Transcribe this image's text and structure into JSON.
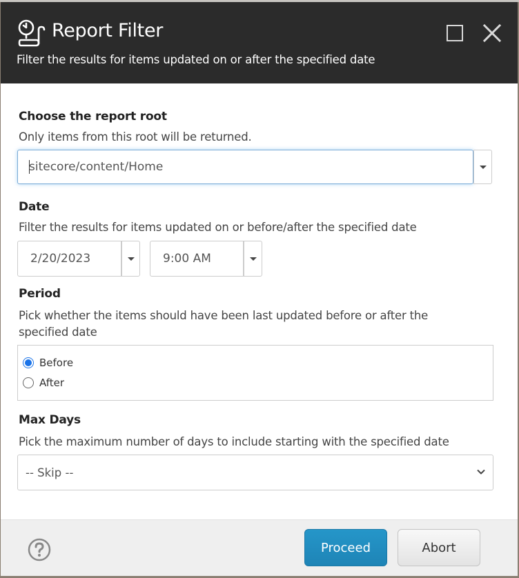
{
  "window": {
    "title": "Report Filter",
    "subtitle": "Filter the results for items updated on or after the specified date",
    "icons": {
      "logo": "clock-scroll-icon",
      "maximize": "maximize-icon",
      "close": "close-icon"
    }
  },
  "form": {
    "root": {
      "label": "Choose the report root",
      "help": "Only items from this root will be returned.",
      "value": "sitecore/content/Home"
    },
    "date": {
      "label": "Date",
      "help": "Filter the results for items updated on or before/after the specified date",
      "date_value": "2/20/2023",
      "time_value": "9:00 AM"
    },
    "period": {
      "label": "Period",
      "help": "Pick whether the items should have been last updated before or after the specified date",
      "options": [
        {
          "label": "Before",
          "checked": true
        },
        {
          "label": "After",
          "checked": false
        }
      ]
    },
    "max_days": {
      "label": "Max Days",
      "help": "Pick the maximum number of days to include starting with the specified date",
      "selected": "-- Skip --"
    }
  },
  "footer": {
    "help_icon": "question-circle-icon",
    "proceed_label": "Proceed",
    "abort_label": "Abort",
    "accent_color": "#2191c4"
  }
}
